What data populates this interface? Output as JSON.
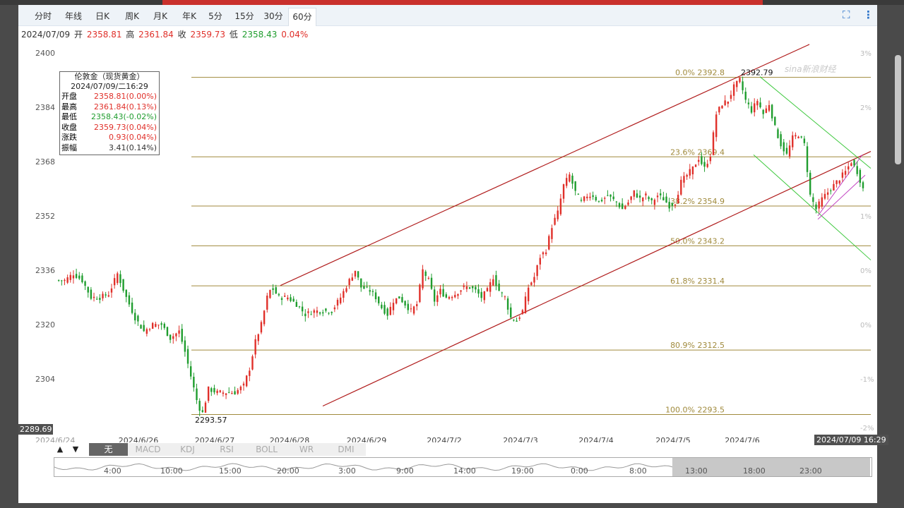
{
  "tabs": [
    "分时",
    "年线",
    "日K",
    "周K",
    "月K",
    "年K",
    "5分",
    "15分",
    "30分",
    "60分"
  ],
  "active_tab": "60分",
  "toolbar_icons": [
    "fullscreen-icon",
    "more-vertical-icon"
  ],
  "ohlc_line": {
    "date": "2024/07/09",
    "open_label": "开",
    "open": "2358.81",
    "high_label": "高",
    "high": "2361.84",
    "close_label": "收",
    "close": "2359.73",
    "low_label": "低",
    "low": "2358.43",
    "change": "0.04%"
  },
  "info_box": {
    "title": "伦敦金（现货黄金）",
    "datetime": "2024/07/09/二16:29",
    "rows": [
      {
        "label": "开盘",
        "value": "2358.81(0.00%)",
        "color": "#e0302a"
      },
      {
        "label": "最高",
        "value": "2361.84(0.13%)",
        "color": "#e0302a"
      },
      {
        "label": "最低",
        "value": "2358.43(-0.02%)",
        "color": "#1f9d2e"
      },
      {
        "label": "收盘",
        "value": "2359.73(0.04%)",
        "color": "#e0302a"
      },
      {
        "label": "涨跌",
        "value": "0.93(0.04%)",
        "color": "#e0302a"
      },
      {
        "label": "振幅",
        "value": "3.41(0.14%)",
        "color": "#333333"
      }
    ]
  },
  "indicator_tabs": [
    "无",
    "MACD",
    "KDJ",
    "RSI",
    "BOLL",
    "WR",
    "DMI"
  ],
  "active_indicator": "无",
  "arrows": [
    "▲",
    "▼"
  ],
  "navigator_labels": [
    "4:00",
    "10:00",
    "15:00",
    "20:00",
    "3:00",
    "9:00",
    "14:00",
    "19:00",
    "0:00",
    "8:00",
    "13:00",
    "18:00",
    "23:00"
  ],
  "watermark": "sina新浪财经",
  "colors": {
    "up": "#e0302a",
    "down": "#1f9d2e",
    "fib": "#a08a3c",
    "channel": "#b01c1c",
    "down_channel": "#3cc83c",
    "wedge": "#c040c0",
    "accent": "#2a72c9"
  },
  "chart_data": {
    "type": "candlestick",
    "title": "伦敦金（现货黄金）",
    "timeframe": "60分",
    "y_ticks": [
      2304,
      2320,
      2336,
      2352,
      2368,
      2384,
      2400
    ],
    "ylim": [
      2289.69,
      2402
    ],
    "x_ticks": [
      "2024/6/26",
      "2024/6/27",
      "2024/6/28",
      "2024/6/29",
      "2024/7/2",
      "2024/7/3",
      "2024/7/4",
      "2024/7/5",
      "2024/7/6"
    ],
    "x_start_label": "2024/6/24",
    "x_end_label": "2024/07/09 16:29",
    "y_min_label": "2289.69",
    "pct_ticks": [
      "3%",
      "2%",
      "1%",
      "0%",
      "0%",
      "-1%",
      "-2%"
    ],
    "high_annotation": {
      "label": "2392.79",
      "value": 2392.79
    },
    "low_annotation": {
      "label": "2293.57",
      "value": 2293.57
    },
    "fibonacci": [
      {
        "label": "0.0% 2392.8",
        "value": 2392.8
      },
      {
        "label": "23.6% 2369.4",
        "value": 2369.4
      },
      {
        "label": "38.2% 2354.9",
        "value": 2354.9
      },
      {
        "label": "50.0% 2343.2",
        "value": 2343.2
      },
      {
        "label": "61.8% 2331.4",
        "value": 2331.4
      },
      {
        "label": "80.9% 2312.5",
        "value": 2312.5
      },
      {
        "label": "100.0% 2293.5",
        "value": 2293.5
      }
    ],
    "price_path": [
      [
        0,
        2333
      ],
      [
        6,
        2333
      ],
      [
        12,
        2335
      ],
      [
        18,
        2333
      ],
      [
        24,
        2328
      ],
      [
        30,
        2328
      ],
      [
        36,
        2329
      ],
      [
        42,
        2335
      ],
      [
        48,
        2328
      ],
      [
        54,
        2322
      ],
      [
        60,
        2318
      ],
      [
        66,
        2320
      ],
      [
        72,
        2320
      ],
      [
        78,
        2316
      ],
      [
        84,
        2318
      ],
      [
        88,
        2312
      ],
      [
        93,
        2303
      ],
      [
        97,
        2296
      ],
      [
        100,
        2294
      ],
      [
        104,
        2301
      ],
      [
        110,
        2300
      ],
      [
        116,
        2300
      ],
      [
        122,
        2300
      ],
      [
        128,
        2302
      ],
      [
        132,
        2307
      ],
      [
        136,
        2315
      ],
      [
        140,
        2320
      ],
      [
        144,
        2328
      ],
      [
        147,
        2331
      ],
      [
        152,
        2328
      ],
      [
        158,
        2328
      ],
      [
        164,
        2326
      ],
      [
        170,
        2323
      ],
      [
        176,
        2324
      ],
      [
        182,
        2324
      ],
      [
        188,
        2324
      ],
      [
        194,
        2328
      ],
      [
        200,
        2333
      ],
      [
        204,
        2336
      ],
      [
        208,
        2331
      ],
      [
        214,
        2330
      ],
      [
        218,
        2328
      ],
      [
        222,
        2325
      ],
      [
        226,
        2323
      ],
      [
        230,
        2327
      ],
      [
        234,
        2328
      ],
      [
        238,
        2326
      ],
      [
        242,
        2324
      ],
      [
        246,
        2326
      ],
      [
        250,
        2336
      ],
      [
        254,
        2333
      ],
      [
        258,
        2327
      ],
      [
        262,
        2330
      ],
      [
        266,
        2328
      ],
      [
        272,
        2329
      ],
      [
        278,
        2331
      ],
      [
        282,
        2331
      ],
      [
        286,
        2330
      ],
      [
        290,
        2328
      ],
      [
        294,
        2330
      ],
      [
        298,
        2334
      ],
      [
        302,
        2330
      ],
      [
        306,
        2328
      ],
      [
        310,
        2322
      ],
      [
        314,
        2321
      ],
      [
        318,
        2324
      ],
      [
        322,
        2331
      ],
      [
        326,
        2334
      ],
      [
        330,
        2340
      ],
      [
        334,
        2342
      ],
      [
        338,
        2349
      ],
      [
        342,
        2353
      ],
      [
        346,
        2361
      ],
      [
        350,
        2364
      ],
      [
        354,
        2359
      ],
      [
        358,
        2356
      ],
      [
        362,
        2358
      ],
      [
        366,
        2358
      ],
      [
        370,
        2356
      ],
      [
        376,
        2358
      ],
      [
        382,
        2356
      ],
      [
        386,
        2354
      ],
      [
        390,
        2356
      ],
      [
        394,
        2359
      ],
      [
        398,
        2357
      ],
      [
        402,
        2358
      ],
      [
        406,
        2356
      ],
      [
        410,
        2358
      ],
      [
        414,
        2357
      ],
      [
        418,
        2355
      ],
      [
        422,
        2356
      ],
      [
        426,
        2362
      ],
      [
        430,
        2364
      ],
      [
        434,
        2366
      ],
      [
        438,
        2369
      ],
      [
        442,
        2366
      ],
      [
        446,
        2370
      ],
      [
        450,
        2382
      ],
      [
        454,
        2385
      ],
      [
        458,
        2386
      ],
      [
        462,
        2390
      ],
      [
        466,
        2392
      ],
      [
        470,
        2386
      ],
      [
        474,
        2383
      ],
      [
        478,
        2386
      ],
      [
        482,
        2382
      ],
      [
        486,
        2385
      ],
      [
        490,
        2378
      ],
      [
        494,
        2373
      ],
      [
        498,
        2370
      ],
      [
        502,
        2375
      ],
      [
        506,
        2376
      ],
      [
        510,
        2373
      ],
      [
        514,
        2358
      ],
      [
        518,
        2354
      ],
      [
        522,
        2357
      ],
      [
        526,
        2359
      ],
      [
        530,
        2361
      ],
      [
        534,
        2363
      ],
      [
        538,
        2365
      ],
      [
        542,
        2368
      ],
      [
        546,
        2365
      ],
      [
        550,
        2360
      ]
    ]
  }
}
